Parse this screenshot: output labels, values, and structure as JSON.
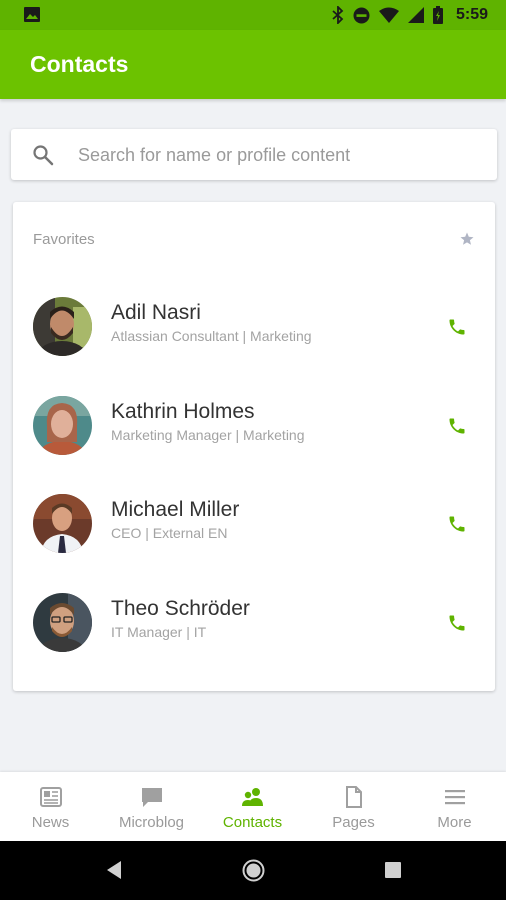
{
  "status_bar": {
    "time": "5:59"
  },
  "header": {
    "title": "Contacts"
  },
  "search": {
    "placeholder": "Search for name or profile content"
  },
  "favorites": {
    "label": "Favorites",
    "contacts": [
      {
        "name": "Adil Nasri",
        "role": "Atlassian Consultant | Marketing"
      },
      {
        "name": "Kathrin Holmes",
        "role": "Marketing Manager | Marketing"
      },
      {
        "name": "Michael Miller",
        "role": "CEO | External EN"
      },
      {
        "name": "Theo Schröder",
        "role": "IT Manager | IT"
      }
    ]
  },
  "bottom_nav": {
    "items": [
      {
        "label": "News",
        "icon": "news-icon"
      },
      {
        "label": "Microblog",
        "icon": "microblog-icon"
      },
      {
        "label": "Contacts",
        "icon": "contacts-icon",
        "active": true
      },
      {
        "label": "Pages",
        "icon": "pages-icon"
      },
      {
        "label": "More",
        "icon": "menu-icon"
      }
    ]
  },
  "colors": {
    "brand": "#6cc200",
    "status_bar": "#5fb300",
    "accent": "#5fb300",
    "text_secondary": "#9a9a9a"
  }
}
